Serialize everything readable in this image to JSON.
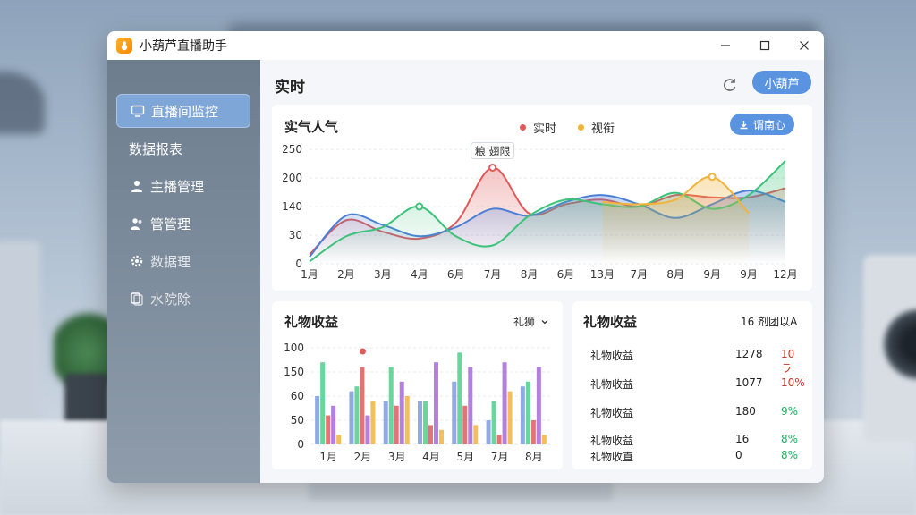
{
  "window": {
    "title": "小葫芦直播助手",
    "controls": [
      "minimize",
      "maximize",
      "close"
    ]
  },
  "sidebar": {
    "items": [
      {
        "label": "直播间监控",
        "icon": "monitor-icon",
        "active": true
      },
      {
        "label": "数据报表",
        "icon": "",
        "active": false
      },
      {
        "label": "主播管理",
        "icon": "user-icon",
        "active": false
      },
      {
        "label": "管管理",
        "icon": "users-icon",
        "active": false
      },
      {
        "label": "数据理",
        "icon": "gear-icon",
        "active": false
      },
      {
        "label": "水院除",
        "icon": "copy-icon",
        "active": false
      }
    ]
  },
  "header": {
    "page_title": "实时",
    "user_button": "小葫芦"
  },
  "popularity_card": {
    "title": "实气人气",
    "legend": [
      {
        "label": "实时",
        "color": "#e05a5a"
      },
      {
        "label": "视衔",
        "color": "#f0b43c"
      }
    ],
    "action_button": "谓南心",
    "tooltip": "粮 翅限"
  },
  "gift_card": {
    "title": "礼物收益",
    "dropdown": "礼狮"
  },
  "stats_card": {
    "title": "礼物收益",
    "header_right": "16 剂团以A",
    "rows": [
      {
        "name": "礼物收益",
        "value": "1278",
        "pct": "10ラ",
        "pct_color": "#c0392b"
      },
      {
        "name": "礼物收益",
        "value": "1077",
        "pct": "10%",
        "pct_color": "#c0392b"
      },
      {
        "name": "礼物收益",
        "value": "180",
        "pct": "9%",
        "pct_color": "#27ae60"
      },
      {
        "name": "礼物收益",
        "value": "16",
        "pct": "8%",
        "pct_color": "#27ae60"
      },
      {
        "name": "礼物收直",
        "value": "0",
        "pct": "8%",
        "pct_color": "#27ae60"
      }
    ]
  },
  "chart_data": [
    {
      "type": "line",
      "title": "实气人气",
      "x": [
        "1月",
        "2月",
        "3月",
        "4月",
        "6月",
        "7月",
        "8月",
        "6月",
        "13月",
        "7月",
        "8月",
        "9月",
        "9月",
        "12月"
      ],
      "y_ticks": [
        "0",
        "30",
        "140",
        "200",
        "250"
      ],
      "ylim": [
        0,
        250
      ],
      "series": [
        {
          "name": "实时",
          "color": "#e05a5a",
          "values": [
            20,
            95,
            70,
            55,
            90,
            210,
            110,
            130,
            140,
            125,
            150,
            145,
            145,
            165
          ]
        },
        {
          "name": "",
          "color": "#4a7fd6",
          "values": [
            15,
            105,
            85,
            60,
            80,
            120,
            105,
            135,
            150,
            130,
            100,
            130,
            160,
            135
          ]
        },
        {
          "name": "",
          "color": "#3cc27a",
          "values": [
            5,
            60,
            80,
            125,
            60,
            40,
            105,
            140,
            130,
            125,
            155,
            120,
            150,
            225
          ]
        },
        {
          "name": "视衔",
          "color": "#f0b43c",
          "values": [
            null,
            null,
            null,
            null,
            null,
            null,
            null,
            null,
            135,
            130,
            140,
            190,
            110,
            null
          ]
        }
      ],
      "grid": true,
      "legend": "top-right"
    },
    {
      "type": "bar",
      "title": "礼物收益",
      "categories": [
        "1月",
        "2月",
        "3月",
        "4月",
        "5月",
        "7月",
        "8月"
      ],
      "y_ticks": [
        "0",
        "50",
        "60",
        "150",
        "100"
      ],
      "ylim": [
        0,
        100
      ],
      "series": [
        {
          "name": "",
          "color": "#7e9be0",
          "values": [
            50,
            55,
            45,
            45,
            65,
            25,
            60
          ]
        },
        {
          "name": "",
          "color": "#4dcf8c",
          "values": [
            85,
            60,
            80,
            45,
            95,
            45,
            65
          ]
        },
        {
          "name": "",
          "color": "#e05a5a",
          "values": [
            30,
            80,
            40,
            20,
            40,
            10,
            25
          ]
        },
        {
          "name": "",
          "color": "#a46ad9",
          "values": [
            40,
            30,
            65,
            85,
            80,
            85,
            80
          ]
        },
        {
          "name": "",
          "color": "#f0b43c",
          "values": [
            10,
            45,
            50,
            15,
            20,
            55,
            10
          ]
        }
      ],
      "grid": true
    }
  ]
}
